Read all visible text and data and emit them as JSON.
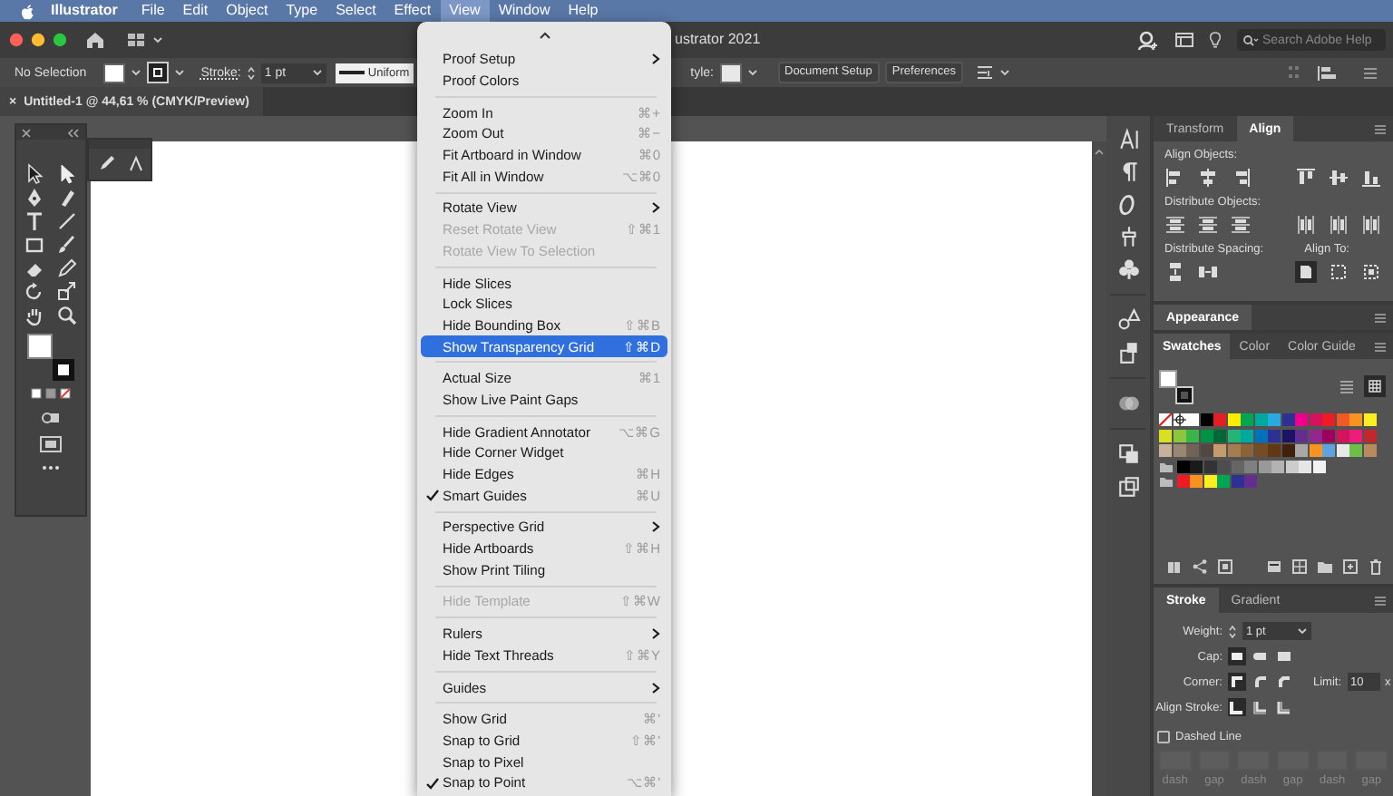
{
  "menubar": {
    "app": "Illustrator",
    "items": [
      {
        "label": "File",
        "selected": false
      },
      {
        "label": "Edit",
        "selected": false
      },
      {
        "label": "Object",
        "selected": false
      },
      {
        "label": "Type",
        "selected": false
      },
      {
        "label": "Select",
        "selected": false
      },
      {
        "label": "Effect",
        "selected": false
      },
      {
        "label": "View",
        "selected": true
      },
      {
        "label": "Window",
        "selected": false
      },
      {
        "label": "Help",
        "selected": false
      }
    ]
  },
  "appbar": {
    "title": "ustrator 2021",
    "search": {
      "placeholder": "Search Adobe Help"
    }
  },
  "controlbar": {
    "selection": "No Selection",
    "stroke_label": "Stroke:",
    "stroke_weight": "1 pt",
    "profile": "Uniform",
    "style_label": "tyle:",
    "buttons": [
      "Document Setup",
      "Preferences"
    ]
  },
  "document_tab": {
    "close": "×",
    "title": "Untitled-1 @ 44,61 % (CMYK/Preview)"
  },
  "view_menu": {
    "sections": [
      [
        {
          "label": "Proof Setup",
          "kind": "submenu",
          "disabled": false,
          "checked": false,
          "selected": false
        },
        {
          "label": "Proof Colors",
          "kind": "command",
          "disabled": false,
          "checked": false,
          "selected": false
        }
      ],
      [
        {
          "label": "Zoom In",
          "shortcut": "⌘+",
          "kind": "command",
          "disabled": false,
          "checked": false,
          "selected": false
        },
        {
          "label": "Zoom Out",
          "shortcut": "⌘−",
          "kind": "command",
          "disabled": false,
          "checked": false,
          "selected": false
        },
        {
          "label": "Fit Artboard in Window",
          "shortcut": "⌘0",
          "kind": "command",
          "disabled": false,
          "checked": false,
          "selected": false
        },
        {
          "label": "Fit All in Window",
          "shortcut": "⌥⌘0",
          "kind": "command",
          "disabled": false,
          "checked": false,
          "selected": false
        }
      ],
      [
        {
          "label": "Rotate View",
          "kind": "submenu",
          "disabled": false,
          "checked": false,
          "selected": false
        },
        {
          "label": "Reset Rotate View",
          "shortcut": "⇧⌘1",
          "kind": "command",
          "disabled": true,
          "checked": false,
          "selected": false
        },
        {
          "label": "Rotate View To Selection",
          "kind": "command",
          "disabled": true,
          "checked": false,
          "selected": false
        }
      ],
      [
        {
          "label": "Hide Slices",
          "kind": "command",
          "disabled": false,
          "checked": false,
          "selected": false
        },
        {
          "label": "Lock Slices",
          "kind": "command",
          "disabled": false,
          "checked": false,
          "selected": false
        },
        {
          "label": "Hide Bounding Box",
          "shortcut": "⇧⌘B",
          "kind": "command",
          "disabled": false,
          "checked": false,
          "selected": false
        },
        {
          "label": "Show Transparency Grid",
          "shortcut": "⇧⌘D",
          "kind": "command",
          "disabled": false,
          "checked": false,
          "selected": true
        }
      ],
      [
        {
          "label": "Actual Size",
          "shortcut": "⌘1",
          "kind": "command",
          "disabled": false,
          "checked": false,
          "selected": false
        },
        {
          "label": "Show Live Paint Gaps",
          "kind": "command",
          "disabled": false,
          "checked": false,
          "selected": false
        }
      ],
      [
        {
          "label": "Hide Gradient Annotator",
          "shortcut": "⌥⌘G",
          "kind": "command",
          "disabled": false,
          "checked": false,
          "selected": false
        },
        {
          "label": "Hide Corner Widget",
          "kind": "command",
          "disabled": false,
          "checked": false,
          "selected": false
        },
        {
          "label": "Hide Edges",
          "shortcut": "⌘H",
          "kind": "command",
          "disabled": false,
          "checked": false,
          "selected": false
        },
        {
          "label": "Smart Guides",
          "shortcut": "⌘U",
          "kind": "command",
          "disabled": false,
          "checked": true,
          "selected": false
        }
      ],
      [
        {
          "label": "Perspective Grid",
          "kind": "submenu",
          "disabled": false,
          "checked": false,
          "selected": false
        },
        {
          "label": "Hide Artboards",
          "shortcut": "⇧⌘H",
          "kind": "command",
          "disabled": false,
          "checked": false,
          "selected": false
        },
        {
          "label": "Show Print Tiling",
          "kind": "command",
          "disabled": false,
          "checked": false,
          "selected": false
        }
      ],
      [
        {
          "label": "Hide Template",
          "shortcut": "⇧⌘W",
          "kind": "command",
          "disabled": true,
          "checked": false,
          "selected": false
        }
      ],
      [
        {
          "label": "Rulers",
          "kind": "submenu",
          "disabled": false,
          "checked": false,
          "selected": false
        },
        {
          "label": "Hide Text Threads",
          "shortcut": "⇧⌘Y",
          "kind": "command",
          "disabled": false,
          "checked": false,
          "selected": false
        }
      ],
      [
        {
          "label": "Guides",
          "kind": "submenu",
          "disabled": false,
          "checked": false,
          "selected": false
        }
      ],
      [
        {
          "label": "Show Grid",
          "shortcut": "⌘'",
          "kind": "command",
          "disabled": false,
          "checked": false,
          "selected": false
        },
        {
          "label": "Snap to Grid",
          "shortcut": "⇧⌘'",
          "kind": "command",
          "disabled": false,
          "checked": false,
          "selected": false
        },
        {
          "label": "Snap to Pixel",
          "kind": "command",
          "disabled": false,
          "checked": false,
          "selected": false
        },
        {
          "label": "Snap to Point",
          "shortcut": "⌥⌘'",
          "kind": "command",
          "disabled": false,
          "checked": true,
          "selected": false
        }
      ]
    ]
  },
  "align_panel": {
    "tabs": [
      {
        "label": "Transform",
        "selected": false
      },
      {
        "label": "Align",
        "selected": true
      }
    ],
    "align_objects": "Align Objects:",
    "distribute_objects": "Distribute Objects:",
    "distribute_spacing": "Distribute Spacing:",
    "align_to": "Align To:"
  },
  "appearance_panel": {
    "tabs": [
      {
        "label": "Appearance",
        "selected": true
      }
    ]
  },
  "swatches_panel": {
    "tabs": [
      {
        "label": "Swatches",
        "selected": true
      },
      {
        "label": "Color",
        "selected": false
      },
      {
        "label": "Color Guide",
        "selected": false
      }
    ],
    "rows": [
      {
        "folder": false,
        "swatches": [
          {
            "kind": "none"
          },
          {
            "kind": "registration"
          },
          {
            "kind": "color",
            "color": "#ffffff"
          },
          {
            "kind": "color",
            "color": "#000000"
          },
          {
            "kind": "color",
            "color": "#e31e24"
          },
          {
            "kind": "color",
            "color": "#ffed00"
          },
          {
            "kind": "color",
            "color": "#00a650"
          },
          {
            "kind": "color",
            "color": "#00a99d"
          },
          {
            "kind": "color",
            "color": "#29abe2"
          },
          {
            "kind": "color",
            "color": "#2e3192"
          },
          {
            "kind": "color",
            "color": "#ec008c"
          },
          {
            "kind": "color",
            "color": "#d4145a"
          },
          {
            "kind": "color",
            "color": "#ed1c24"
          },
          {
            "kind": "color",
            "color": "#f15a24"
          },
          {
            "kind": "color",
            "color": "#f7931e"
          },
          {
            "kind": "color",
            "color": "#fcee21"
          }
        ]
      },
      {
        "folder": false,
        "swatches": [
          {
            "kind": "color",
            "color": "#d9e021"
          },
          {
            "kind": "color",
            "color": "#8cc63f"
          },
          {
            "kind": "color",
            "color": "#39b54a"
          },
          {
            "kind": "color",
            "color": "#009245"
          },
          {
            "kind": "color",
            "color": "#006837"
          },
          {
            "kind": "color",
            "color": "#22b573"
          },
          {
            "kind": "color",
            "color": "#00a99d"
          },
          {
            "kind": "color",
            "color": "#0071bc"
          },
          {
            "kind": "color",
            "color": "#2e3192"
          },
          {
            "kind": "color",
            "color": "#1b1464"
          },
          {
            "kind": "color",
            "color": "#662d91"
          },
          {
            "kind": "color",
            "color": "#93278f"
          },
          {
            "kind": "color",
            "color": "#9e005d"
          },
          {
            "kind": "color",
            "color": "#d4145a"
          },
          {
            "kind": "color",
            "color": "#ed1e79"
          },
          {
            "kind": "color",
            "color": "#c1272d"
          }
        ]
      },
      {
        "folder": false,
        "swatches": [
          {
            "kind": "color",
            "color": "#c7b299"
          },
          {
            "kind": "color",
            "color": "#998675"
          },
          {
            "kind": "color",
            "color": "#736357"
          },
          {
            "kind": "color",
            "color": "#534741"
          },
          {
            "kind": "color",
            "color": "#c69c6d"
          },
          {
            "kind": "color",
            "color": "#a67c52"
          },
          {
            "kind": "color",
            "color": "#8c6239"
          },
          {
            "kind": "color",
            "color": "#754c24"
          },
          {
            "kind": "color",
            "color": "#603813"
          },
          {
            "kind": "color",
            "color": "#42210b"
          },
          {
            "kind": "color",
            "color": "#a8a8a8"
          },
          {
            "kind": "color",
            "color": "#f7931e"
          },
          {
            "kind": "color",
            "color": "#5da3e0"
          },
          {
            "kind": "color",
            "color": "#e8e8e8"
          },
          {
            "kind": "color",
            "color": "#6cc04a"
          },
          {
            "kind": "color",
            "color": "#b88a5c"
          }
        ]
      },
      {
        "folder": true,
        "swatches": [
          {
            "kind": "color",
            "color": "#000000"
          },
          {
            "kind": "color",
            "color": "#1a1a1a"
          },
          {
            "kind": "color",
            "color": "#333333"
          },
          {
            "kind": "color",
            "color": "#4d4d4d"
          },
          {
            "kind": "color",
            "color": "#666666"
          },
          {
            "kind": "color",
            "color": "#808080"
          },
          {
            "kind": "color",
            "color": "#999999"
          },
          {
            "kind": "color",
            "color": "#b3b3b3"
          },
          {
            "kind": "color",
            "color": "#cccccc"
          },
          {
            "kind": "color",
            "color": "#e6e6e6"
          },
          {
            "kind": "color",
            "color": "#f2f2f2"
          }
        ]
      },
      {
        "folder": true,
        "swatches": [
          {
            "kind": "color",
            "color": "#ed1c24"
          },
          {
            "kind": "color",
            "color": "#f7931e"
          },
          {
            "kind": "color",
            "color": "#fcee21"
          },
          {
            "kind": "color",
            "color": "#00a651"
          },
          {
            "kind": "color",
            "color": "#2e3192"
          },
          {
            "kind": "color",
            "color": "#662d91"
          }
        ]
      }
    ]
  },
  "stroke_panel": {
    "tabs": [
      {
        "label": "Stroke",
        "selected": true
      },
      {
        "label": "Gradient",
        "selected": false
      }
    ],
    "weight_label": "Weight:",
    "weight": "1 pt",
    "cap_label": "Cap:",
    "corner_label": "Corner:",
    "limit_label": "Limit:",
    "limit": "10",
    "limit_unit": "x",
    "align_stroke_label": "Align Stroke:",
    "dashed_line": {
      "label": "Dashed Line",
      "checked": false
    },
    "dash_labels": [
      "dash",
      "gap",
      "dash",
      "gap",
      "dash",
      "gap"
    ]
  }
}
